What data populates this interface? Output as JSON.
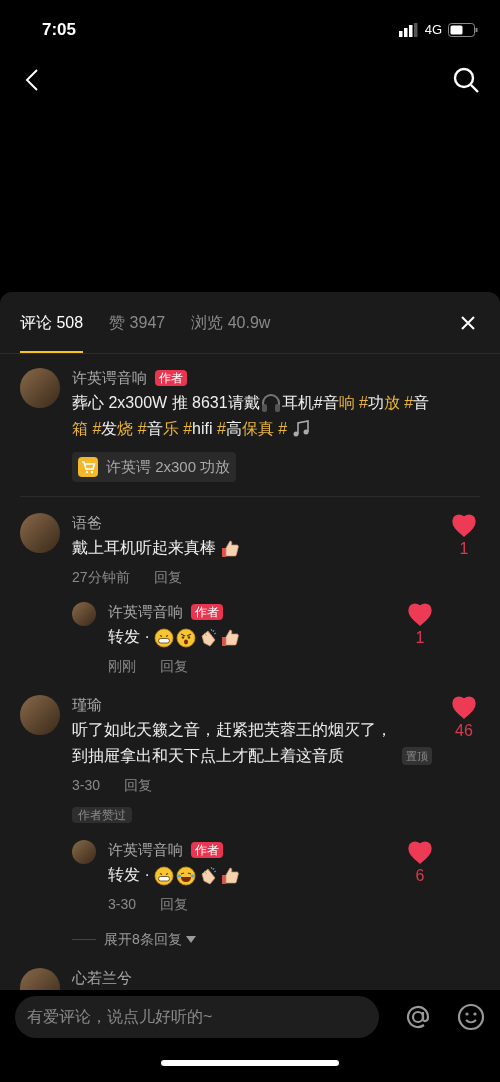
{
  "status_bar": {
    "time": "7:05",
    "network": "4G"
  },
  "tabs": [
    {
      "label": "评论 508",
      "selected": true
    },
    {
      "label": "赞 3947",
      "selected": false
    },
    {
      "label": "浏览 40.9w",
      "selected": false
    }
  ],
  "post": {
    "author": "许英谔音响",
    "badge": "作者",
    "caption": [
      {
        "kind": "text",
        "text": "葬心 2x300W 推 8631请戴",
        "highlight": false
      },
      {
        "kind": "headphones"
      },
      {
        "kind": "text",
        "text": "耳机#音",
        "highlight": false
      },
      {
        "kind": "text",
        "text": "响 #",
        "highlight": true
      },
      {
        "kind": "text",
        "text": "功",
        "highlight": false
      },
      {
        "kind": "text",
        "text": "放 #",
        "highlight": true
      },
      {
        "kind": "text",
        "text": "音",
        "highlight": false
      },
      {
        "kind": "text",
        "text": "箱 #",
        "highlight": true
      },
      {
        "kind": "text",
        "text": "发",
        "highlight": false
      },
      {
        "kind": "text",
        "text": "烧 #",
        "highlight": true
      },
      {
        "kind": "text",
        "text": "音",
        "highlight": false
      },
      {
        "kind": "text",
        "text": "乐 #",
        "highlight": true
      },
      {
        "kind": "text",
        "text": "hifi",
        "highlight": false
      },
      {
        "kind": "text",
        "text": " #",
        "highlight": true
      },
      {
        "kind": "text",
        "text": "高",
        "highlight": false
      },
      {
        "kind": "text",
        "text": "保真 #",
        "highlight": true
      },
      {
        "kind": "music"
      }
    ],
    "product": "许英谔 2x300 功放"
  },
  "comments": [
    {
      "user": "语爸",
      "text": "戴上耳机听起来真棒",
      "emojis": [
        {
          "kind": "thumbs_up"
        }
      ],
      "time": "27分钟前",
      "reply_label": "回复",
      "likes": "1",
      "liked": true,
      "replies": [
        {
          "user": "许英谔音响",
          "badge": "作者",
          "text": "转发 ·",
          "emojis": [
            {
              "kind": "grin"
            },
            {
              "kind": "angry"
            },
            {
              "kind": "clap"
            },
            {
              "kind": "thumbs_up"
            }
          ],
          "time": "刚刚",
          "reply_label": "回复",
          "likes": "1",
          "liked": true
        }
      ]
    },
    {
      "user": "瑾瑜",
      "text": "听了如此天籁之音，赶紧把芙蓉王的烟灭了，到抽屉拿出和天下点上才配上着这音质",
      "pinned": "置顶",
      "time": "3-30",
      "reply_label": "回复",
      "author_liked": "作者赞过",
      "likes": "46",
      "liked": true,
      "replies": [
        {
          "user": "许英谔音响",
          "badge": "作者",
          "text": "转发 ·",
          "emojis": [
            {
              "kind": "grin"
            },
            {
              "kind": "laugh_cry"
            },
            {
              "kind": "clap"
            },
            {
              "kind": "thumbs_up"
            }
          ],
          "time": "3-30",
          "reply_label": "回复",
          "likes": "6",
          "liked": true
        }
      ],
      "expand": "展开8条回复"
    },
    {
      "user": "心若兰兮"
    }
  ],
  "composer": {
    "placeholder": "有爱评论，说点儿好听的~"
  }
}
